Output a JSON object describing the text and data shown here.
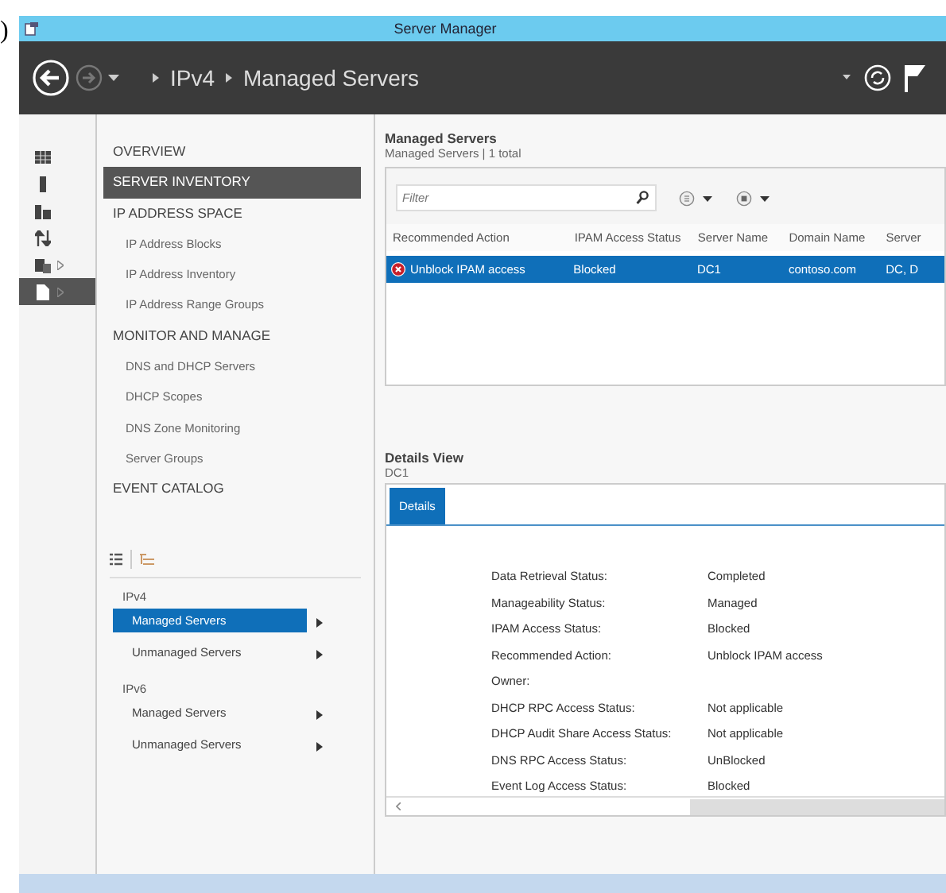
{
  "page_fragment": ")",
  "window": {
    "title": "Server Manager"
  },
  "toolbar": {
    "breadcrumb": [
      {
        "label": "IPv4"
      },
      {
        "label": "Managed Servers"
      }
    ]
  },
  "icon_rail": [
    {
      "kind": "grid",
      "selected": false,
      "expandable": false
    },
    {
      "kind": "server",
      "selected": false,
      "expandable": false
    },
    {
      "kind": "servers",
      "selected": false,
      "expandable": false
    },
    {
      "kind": "arrows",
      "selected": false,
      "expandable": false
    },
    {
      "kind": "stack",
      "selected": false,
      "expandable": true
    },
    {
      "kind": "page",
      "selected": true,
      "expandable": true
    }
  ],
  "nav": [
    {
      "label": "OVERVIEW",
      "selected": false
    },
    {
      "label": "SERVER INVENTORY",
      "selected": true
    },
    {
      "label": "IP ADDRESS SPACE",
      "selected": false,
      "children": [
        {
          "label": "IP Address Blocks",
          "selected": false
        },
        {
          "label": "IP Address Inventory",
          "selected": false
        },
        {
          "label": "IP Address Range Groups",
          "selected": false
        }
      ]
    },
    {
      "label": "MONITOR AND MANAGE",
      "selected": false,
      "children": [
        {
          "label": "DNS and DHCP Servers",
          "selected": false
        },
        {
          "label": "DHCP Scopes",
          "selected": false
        },
        {
          "label": "DNS Zone Monitoring",
          "selected": false
        },
        {
          "label": "Server Groups",
          "selected": false
        }
      ]
    },
    {
      "label": "EVENT CATALOG",
      "selected": false
    }
  ],
  "tree": [
    {
      "label": "IPv4",
      "children": [
        {
          "label": "Managed Servers",
          "selected": true
        },
        {
          "label": "Unmanaged Servers",
          "selected": false
        }
      ]
    },
    {
      "label": "IPv6",
      "children": [
        {
          "label": "Managed Servers",
          "selected": false
        },
        {
          "label": "Unmanaged Servers",
          "selected": false
        }
      ]
    }
  ],
  "servers": {
    "title": "Managed Servers",
    "subtitle": "Managed Servers | 1 total",
    "filter": {
      "placeholder": "Filter"
    },
    "columns": [
      "Recommended Action",
      "IPAM Access Status",
      "Server Name",
      "Domain Name",
      "Server"
    ],
    "rows": [
      {
        "kind": "error",
        "selected": true,
        "cells": [
          "Unblock IPAM access",
          "Blocked",
          "DC1",
          "contoso.com",
          "DC, D"
        ]
      }
    ]
  },
  "details": {
    "title": "Details View",
    "subtitle": "DC1",
    "tabs": [
      {
        "label": "Details",
        "selected": true
      }
    ],
    "fields": [
      {
        "label": "Data Retrieval Status:",
        "value": "Completed"
      },
      {
        "label": "Manageability Status:",
        "value": "Managed"
      },
      {
        "label": "IPAM Access Status:",
        "value": "Blocked"
      },
      {
        "label": "Recommended Action:",
        "value": "Unblock IPAM access"
      },
      {
        "label": "Owner:"
      },
      {
        "label": "DHCP RPC Access Status:",
        "value": "Not applicable"
      },
      {
        "label": "DHCP Audit Share Access Status:",
        "value": "Not applicable"
      },
      {
        "label": "DNS RPC Access Status:",
        "value": "UnBlocked"
      },
      {
        "label": "Event Log Access Status:",
        "value": "Blocked"
      }
    ]
  }
}
